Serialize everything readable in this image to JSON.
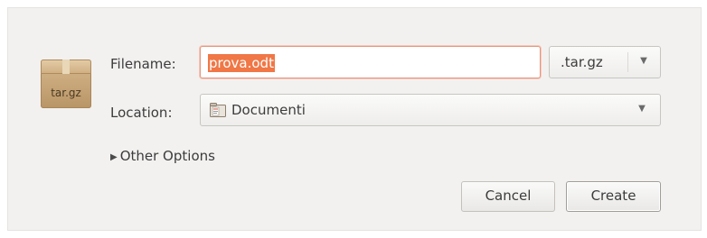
{
  "dialog": {
    "archive_icon_text": "tar.gz",
    "filename_label": "Filename:",
    "filename_value": "prova.odt",
    "format_selected": ".tar.gz",
    "location_label": "Location:",
    "location_value": "Documenti",
    "other_options_label": "Other Options",
    "cancel_label": "Cancel",
    "create_label": "Create"
  },
  "colors": {
    "dialog_bg": "#f2f1f0",
    "selection": "#f07746",
    "focus_border": "#e7967f"
  }
}
